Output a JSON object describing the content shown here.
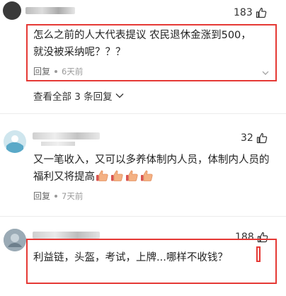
{
  "comments": [
    {
      "likes": "183",
      "text": "怎么之前的人大代表提议 农民退休金涨到500，就没被采纳呢？？？",
      "reply_label": "回复",
      "time": "6天前"
    },
    {
      "likes": "32",
      "text": "又一笔收入，又可以多养体制内人员，体制内人员的福利又将提高",
      "emoji": [
        "thumbs-up",
        "thumbs-up",
        "thumbs-up",
        "thumbs-up"
      ],
      "reply_label": "回复",
      "time": "7天前"
    },
    {
      "likes": "188",
      "text": "利益链，头盔，考试，上牌...哪样不收钱？"
    }
  ],
  "view_all_replies": "查看全部 3 条回复",
  "colors": {
    "highlight_border": "#e53935",
    "emoji_hand": "#f4b183"
  }
}
